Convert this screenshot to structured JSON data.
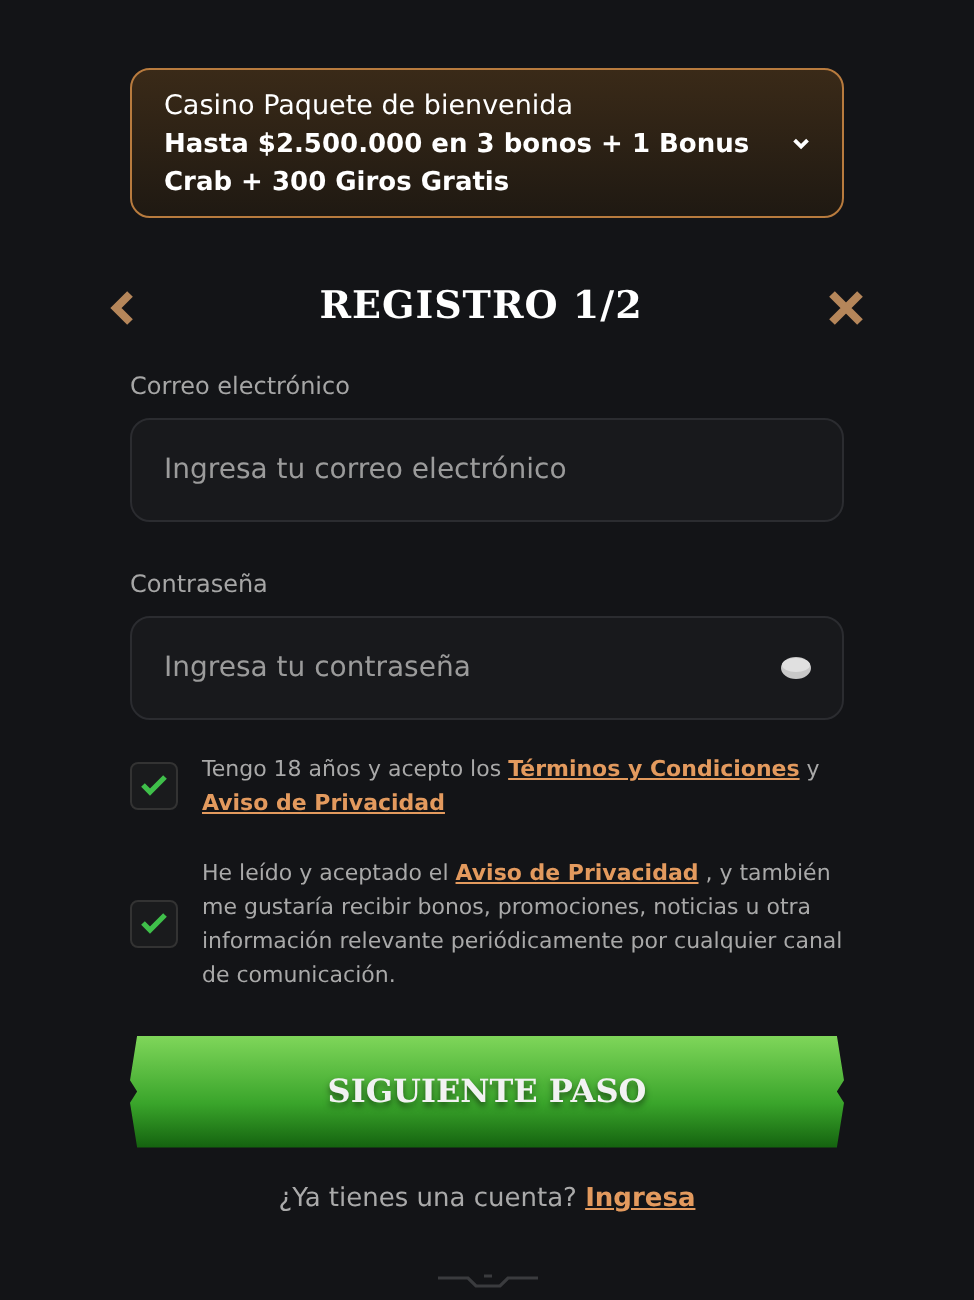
{
  "promo": {
    "label": "Casino Paquete de bienvenida",
    "offer": "Hasta $2.500.000 en 3 bonos + 1 Bonus Crab + 300 Giros Gratis",
    "expanded": false
  },
  "header": {
    "title": "REGISTRO 1/2"
  },
  "fields": [
    {
      "label": "Correo electrónico",
      "placeholder": "Ingresa tu correo electrónico",
      "kind": "email"
    },
    {
      "label": "Contraseña",
      "placeholder": "Ingresa tu contraseña",
      "kind": "password"
    }
  ],
  "consents": [
    {
      "checked": true,
      "parts": [
        {
          "kind": "text",
          "text": "Tengo 18 años y acepto los "
        },
        {
          "kind": "link",
          "text": "Términos y Condiciones"
        },
        {
          "kind": "text",
          "text": " y "
        },
        {
          "kind": "link",
          "text": "Aviso de Privacidad"
        }
      ]
    },
    {
      "checked": true,
      "parts": [
        {
          "kind": "text",
          "text": "He leído y aceptado el "
        },
        {
          "kind": "link",
          "text": "Aviso de Privacidad"
        },
        {
          "kind": "text",
          "text": " , y también me gustaría recibir bonos, promociones, noticias u otra información relevante periódicamente por cualquier canal de comunicación."
        }
      ]
    }
  ],
  "submit": "SIGUIENTE PASO",
  "login": {
    "prompt": "¿Ya tienes una cuenta?",
    "link": "Ingresa"
  }
}
